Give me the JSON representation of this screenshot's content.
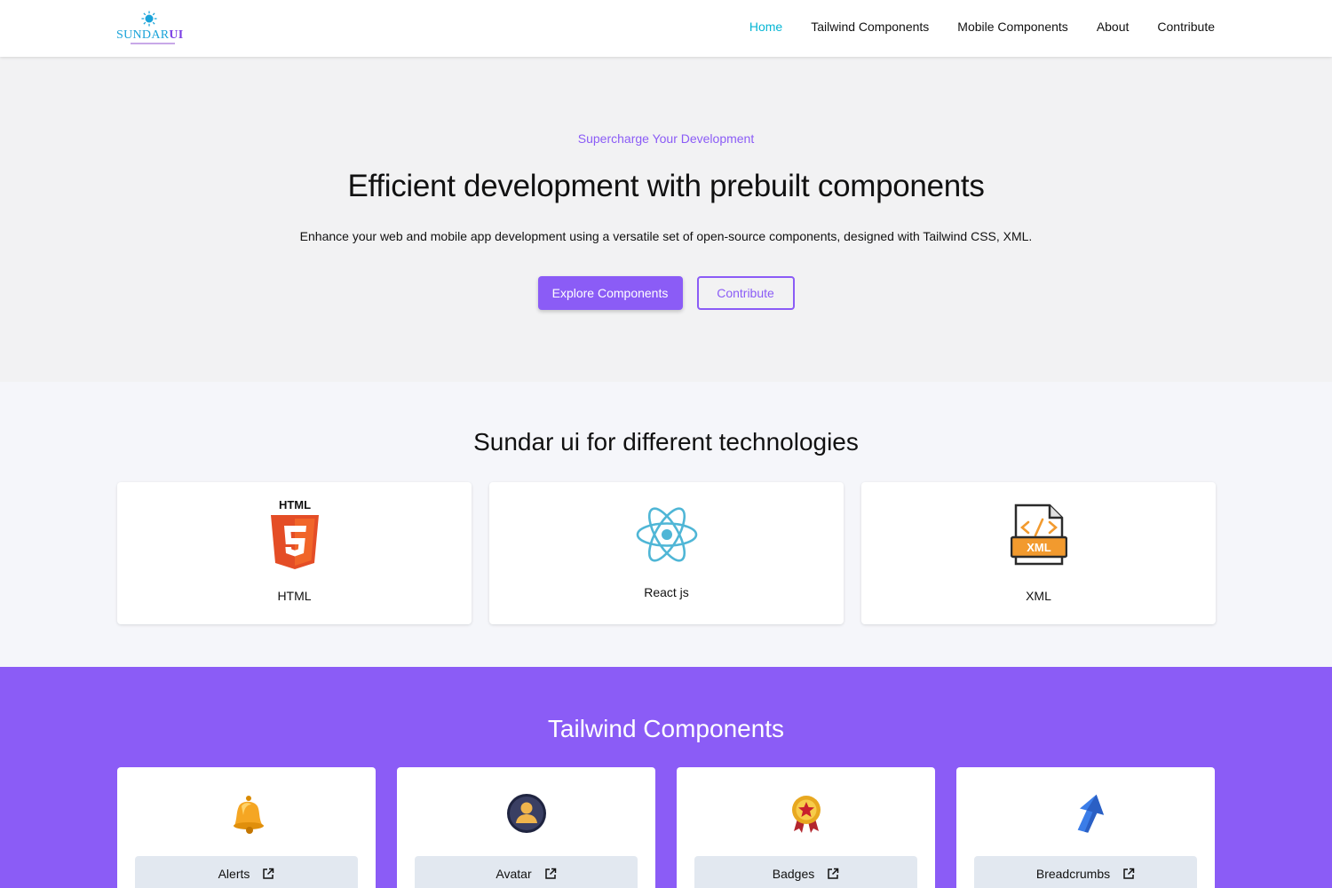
{
  "header": {
    "logo": {
      "text_main": "SUNDAR",
      "text_accent": "UI"
    },
    "nav": [
      {
        "label": "Home",
        "active": true
      },
      {
        "label": "Tailwind Components",
        "active": false
      },
      {
        "label": "Mobile Components",
        "active": false
      },
      {
        "label": "About",
        "active": false
      },
      {
        "label": "Contribute",
        "active": false
      }
    ]
  },
  "hero": {
    "kicker": "Supercharge Your Development",
    "title": "Efficient development with prebuilt components",
    "description": "Enhance your web and mobile app development using a versatile set of open-source components, designed with Tailwind CSS, XML.",
    "primary_button": "Explore Components",
    "secondary_button": "Contribute"
  },
  "technologies": {
    "title": "Sundar ui for different technologies",
    "cards": [
      {
        "label": "HTML",
        "icon": "html5-icon",
        "icon_text": "HTML"
      },
      {
        "label": "React js",
        "icon": "react-icon"
      },
      {
        "label": "XML",
        "icon": "xml-file-icon",
        "icon_text": "XML"
      }
    ]
  },
  "tailwind": {
    "title": "Tailwind Components",
    "cards": [
      {
        "label": "Alerts",
        "icon": "bell-icon"
      },
      {
        "label": "Avatar",
        "icon": "avatar-icon"
      },
      {
        "label": "Badges",
        "icon": "badge-medal-icon"
      },
      {
        "label": "Breadcrumbs",
        "icon": "arrow-icon"
      }
    ]
  },
  "colors": {
    "accent": "#8b5cf6",
    "active_nav": "#06b6d4",
    "hero_bg": "#f2f2f3",
    "tech_bg": "#f5f6fa"
  }
}
